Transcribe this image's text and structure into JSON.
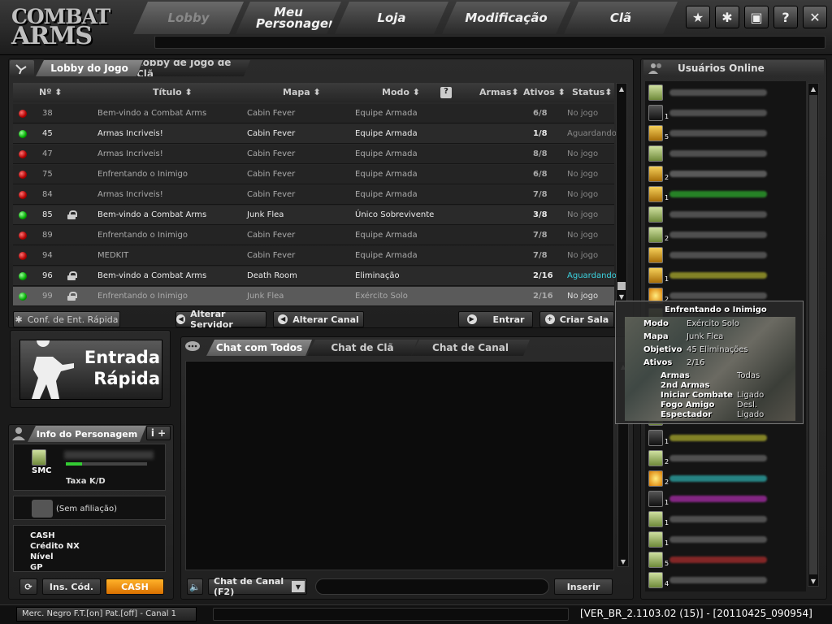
{
  "app": {
    "logo_line1": "COMBAT",
    "logo_line2": "ARMS"
  },
  "nav": {
    "tabs": [
      {
        "label": "Lobby",
        "active": true
      },
      {
        "label": "Meu Personagem",
        "active": false
      },
      {
        "label": "Loja",
        "active": false
      },
      {
        "label": "Modificação",
        "active": false
      },
      {
        "label": "Clã",
        "active": false
      }
    ],
    "icons": [
      "star-icon",
      "gear-icon",
      "lock-icon",
      "help-icon",
      "close-icon"
    ],
    "icon_glyphs": [
      "★",
      "✱",
      "▣",
      "?",
      "✕"
    ]
  },
  "lobby_tabs": [
    {
      "label": "Lobby do Jogo",
      "active": true
    },
    {
      "label": "Lobby de Jogo de Clã",
      "active": false
    }
  ],
  "room_table": {
    "columns": [
      "Nº",
      "Título",
      "Mapa",
      "Modo",
      "Armas",
      "Ativos",
      "Status"
    ],
    "rows": [
      {
        "status_color": "red",
        "locked": false,
        "num": "38",
        "title": "Bem-vindo a Combat Arms",
        "map": "Cabin Fever",
        "mode": "Equipe Armada",
        "active": "6/8",
        "status": "No jogo",
        "state": "closed"
      },
      {
        "status_color": "green",
        "locked": false,
        "num": "45",
        "title": "Armas Incriveis!",
        "map": "Cabin Fever",
        "mode": "Equipe Armada",
        "active": "1/8",
        "status": "Aguardando",
        "state": "open"
      },
      {
        "status_color": "red",
        "locked": false,
        "num": "47",
        "title": "Armas Incriveis!",
        "map": "Cabin Fever",
        "mode": "Equipe Armada",
        "active": "8/8",
        "status": "No jogo",
        "state": "closed"
      },
      {
        "status_color": "red",
        "locked": false,
        "num": "75",
        "title": "Enfrentando o Inimigo",
        "map": "Cabin Fever",
        "mode": "Equipe Armada",
        "active": "6/8",
        "status": "No jogo",
        "state": "closed"
      },
      {
        "status_color": "red",
        "locked": false,
        "num": "84",
        "title": "Armas Incriveis!",
        "map": "Cabin Fever",
        "mode": "Equipe Armada",
        "active": "7/8",
        "status": "No jogo",
        "state": "closed"
      },
      {
        "status_color": "green",
        "locked": true,
        "num": "85",
        "title": "Bem-vindo a Combat Arms",
        "map": "Junk Flea",
        "mode": "Único Sobrevivente",
        "active": "3/8",
        "status": "No jogo",
        "state": "open"
      },
      {
        "status_color": "red",
        "locked": false,
        "num": "89",
        "title": "Enfrentando o Inimigo",
        "map": "Cabin Fever",
        "mode": "Equipe Armada",
        "active": "7/8",
        "status": "No jogo",
        "state": "closed"
      },
      {
        "status_color": "red",
        "locked": false,
        "num": "94",
        "title": "MEDKIT",
        "map": "Cabin Fever",
        "mode": "Equipe Armada",
        "active": "7/8",
        "status": "No jogo",
        "state": "closed"
      },
      {
        "status_color": "green",
        "locked": true,
        "num": "96",
        "title": "Bem-vindo a Combat Arms",
        "map": "Death Room",
        "mode": "Eliminação",
        "active": "2/16",
        "status": "Aguardando",
        "state": "open"
      },
      {
        "status_color": "green",
        "locked": true,
        "num": "99",
        "title": "Enfrentando o Inimigo",
        "map": "Junk Flea",
        "mode": "Exército Solo",
        "active": "2/16",
        "status": "No jogo",
        "state": "selected"
      }
    ]
  },
  "buttons": {
    "quick_config": "Conf. de Ent. Rápida",
    "change_server": "Alterar Servidor",
    "change_channel": "Alterar Canal",
    "enter": "Entrar",
    "create_room": "Criar Sala",
    "quick_entry_line1": "Entrada",
    "quick_entry_line2": "Rápida",
    "ins_cod": "Ins. Cód.",
    "cash": "CASH",
    "send": "Inserir"
  },
  "chat": {
    "tabs": [
      {
        "label": "Chat com Todos",
        "active": true
      },
      {
        "label": "Chat de Clã",
        "active": false
      },
      {
        "label": "Chat de Canal",
        "active": false
      }
    ],
    "channel_select": "Chat de Canal (F2)",
    "input_value": ""
  },
  "character": {
    "header": "Info do Personagem",
    "rank": "SMC",
    "kd_label": "Taxa K/D",
    "affiliation": "(Sem afiliação)",
    "stats_labels": [
      "CASH",
      "Crédito NX",
      "Nível",
      "GP"
    ]
  },
  "users": {
    "header": "Usuários Online",
    "ranks": [
      "green",
      "dark",
      "gold",
      "green",
      "gold",
      "gold",
      "green",
      "green",
      "gold",
      "gold",
      "star",
      "green",
      "gold",
      "gold",
      "gold",
      "gold",
      "green",
      "dark",
      "green",
      "star",
      "dark",
      "green",
      "green",
      "green",
      "green"
    ],
    "badges": [
      "",
      "1",
      "5",
      "",
      "2",
      "1",
      "",
      "2",
      "",
      "1",
      "2",
      "",
      "",
      "",
      "",
      "",
      "",
      "1",
      "2",
      "2",
      "1",
      "1",
      "1",
      "5",
      "4"
    ],
    "name_colors": [
      "#777",
      "#777",
      "#777",
      "#777",
      "#888",
      "#3c3",
      "#777",
      "#777",
      "#777",
      "#cc3",
      "#777",
      "#777",
      "#777",
      "#777",
      "#777",
      "#777",
      "#777",
      "#cc3",
      "#777",
      "#3cc",
      "#c3c",
      "#777",
      "#777",
      "#c33",
      "#777"
    ]
  },
  "tooltip": {
    "room_title": "Enfrentando o Inimigo",
    "rows_top": [
      {
        "label": "Modo",
        "value": "Exército Solo"
      },
      {
        "label": "Mapa",
        "value": "Junk Flea"
      },
      {
        "label": "Objetivo",
        "value": "45 Eliminações"
      },
      {
        "label": "Ativos",
        "value": "2/16"
      }
    ],
    "rows_bottom": [
      {
        "label": "Armas",
        "value": "Todas"
      },
      {
        "label": "2nd Armas",
        "value": ""
      },
      {
        "label": "Iniciar Combate",
        "value": "Ligado"
      },
      {
        "label": "Fogo Amigo",
        "value": "Desl."
      },
      {
        "label": "Espectador",
        "value": "Ligado"
      }
    ]
  },
  "statusbar": {
    "server": "Merc. Negro F.T.[on] Pat.[off] - Canal 1",
    "version": "[VER_BR_2.1103.02 (15)] - [20110425_090954]"
  }
}
